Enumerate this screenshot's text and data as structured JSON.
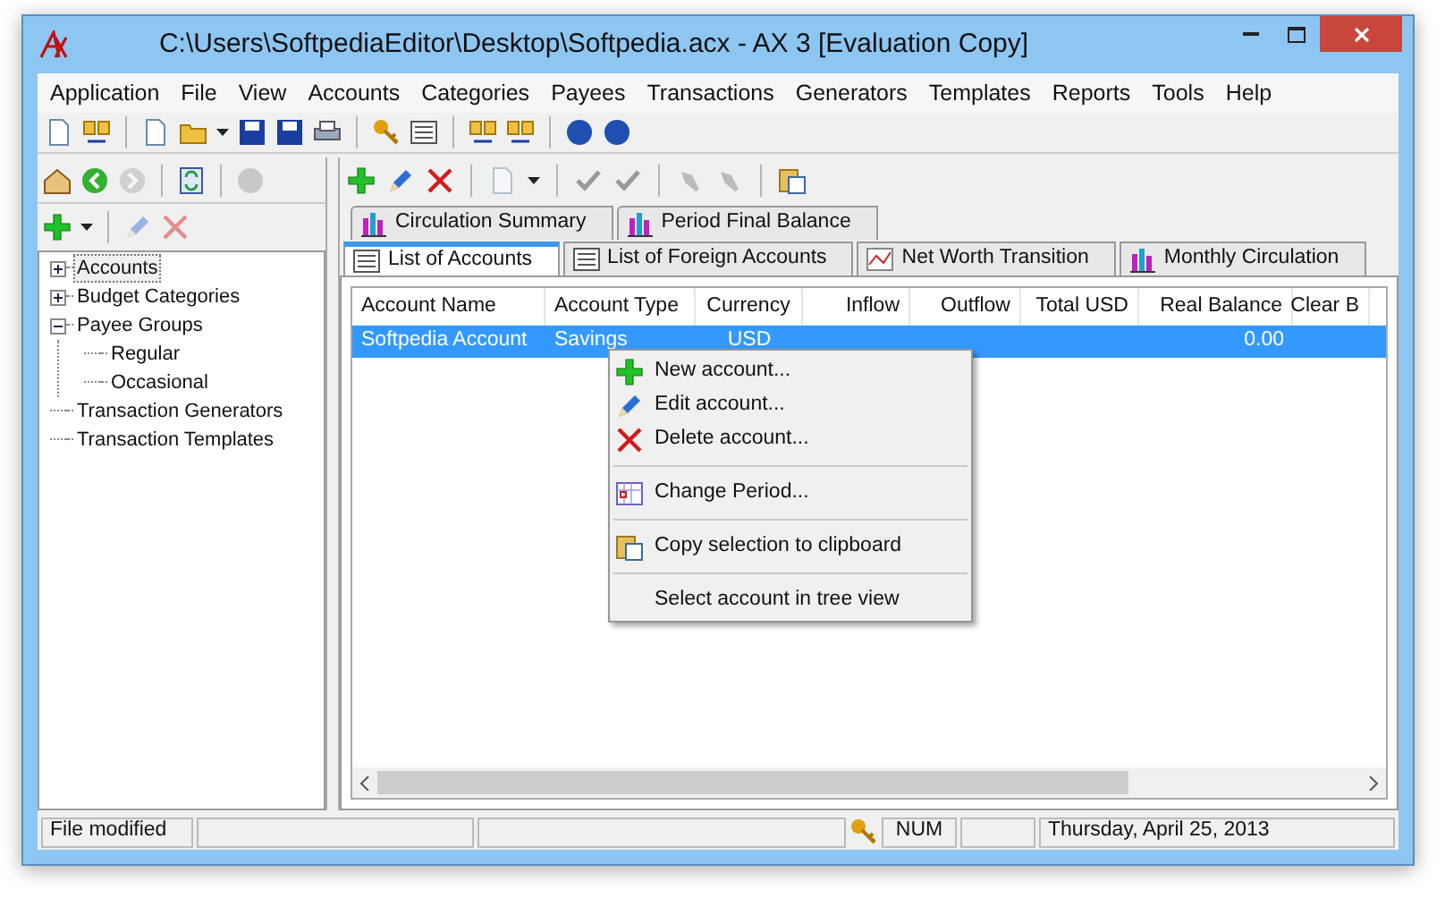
{
  "window": {
    "title": "C:\\Users\\SoftpediaEditor\\Desktop\\Softpedia.acx - AX 3 [Evaluation Copy]"
  },
  "menu": [
    "Application",
    "File",
    "View",
    "Accounts",
    "Categories",
    "Payees",
    "Transactions",
    "Generators",
    "Templates",
    "Reports",
    "Tools",
    "Help"
  ],
  "tree": [
    {
      "label": "Accounts",
      "expanded": false,
      "selected": true
    },
    {
      "label": "Budget Categories",
      "expanded": false,
      "selected": false
    },
    {
      "label": "Payee Groups",
      "expanded": true,
      "selected": false,
      "children": [
        {
          "label": "Regular",
          "selected": false
        },
        {
          "label": "Occasional",
          "selected": false
        }
      ]
    },
    {
      "label": "Transaction Generators",
      "selected": false
    },
    {
      "label": "Transaction Templates",
      "selected": false
    }
  ],
  "report_tabs": [
    {
      "label": "Circulation Summary",
      "selected": false
    },
    {
      "label": "Period Final Balance",
      "selected": false
    }
  ],
  "tabs": [
    {
      "label": "List of Accounts",
      "selected": true
    },
    {
      "label": "List of Foreign Accounts",
      "selected": false
    },
    {
      "label": "Net Worth Transition",
      "selected": false
    },
    {
      "label": "Monthly Circulation",
      "selected": false
    }
  ],
  "table": {
    "columns": [
      "Account Name",
      "Account Type",
      "Currency",
      "Inflow",
      "Outflow",
      "Total USD",
      "Real Balance",
      "Clear B"
    ],
    "rows": [
      {
        "selected": true,
        "cells": [
          "Softpedia Account",
          "Savings",
          "USD",
          "",
          "",
          "",
          "0.00",
          ""
        ]
      }
    ]
  },
  "context_menu": [
    {
      "kind": "item",
      "label": "New account..."
    },
    {
      "kind": "item",
      "label": "Edit account..."
    },
    {
      "kind": "item",
      "label": "Delete account..."
    },
    {
      "kind": "separator"
    },
    {
      "kind": "item",
      "label": "Change Period..."
    },
    {
      "kind": "separator"
    },
    {
      "kind": "item",
      "label": "Copy selection to clipboard"
    },
    {
      "kind": "separator"
    },
    {
      "kind": "item",
      "label": "Select account in tree view"
    }
  ],
  "status_bar": {
    "message": "File modified",
    "indicator": "NUM",
    "date": "Thursday, April 25, 2013"
  }
}
